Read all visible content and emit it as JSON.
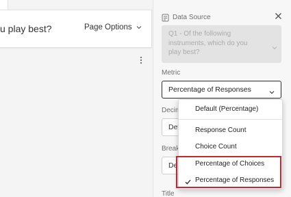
{
  "editor": {
    "question_text": "u play best?",
    "page_options_label": "Page Options"
  },
  "panel": {
    "data_source_label": "Data Source",
    "data_source_value": "Q1 - Of the following instruments, which do you play best?",
    "data_source_lines": [
      "Q1 - Of the following",
      "instruments, which do you",
      "play best?"
    ],
    "metric_label": "Metric",
    "metric_value": "Percentage of Responses",
    "decimal_label": "Decim",
    "decimal_value": "Def",
    "breakout_label": "Break",
    "breakout_value": "De",
    "title_label": "Title"
  },
  "metric_menu": {
    "items": [
      {
        "label": "Default (Percentage)",
        "selected": false
      },
      {
        "label": "Response Count",
        "selected": false
      },
      {
        "label": "Choice Count",
        "selected": false
      },
      {
        "label": "Percentage of Choices",
        "selected": false
      },
      {
        "label": "Percentage of Responses",
        "selected": true
      }
    ]
  },
  "icons": {
    "data_source": "data-source-icon",
    "close": "close-icon",
    "chevron": "chevron-down-icon",
    "kebab": "kebab-menu-icon",
    "check": "checkmark-icon"
  },
  "colors": {
    "highlight_border": "#c8242b",
    "panel_background": "#f7f7f7",
    "disabled_field": "#e3e3e3"
  }
}
